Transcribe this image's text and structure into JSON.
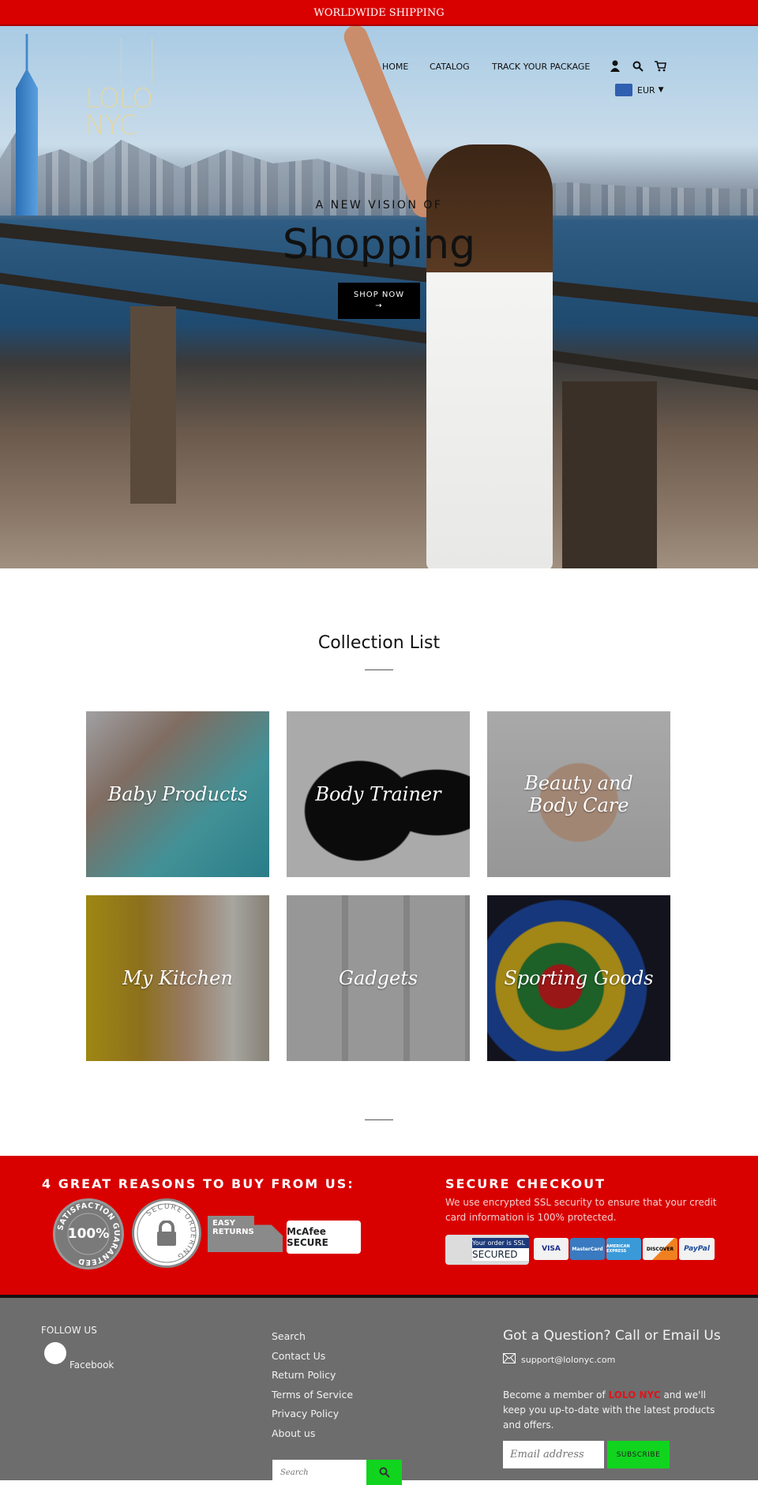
{
  "announcement": "WORLDWIDE SHIPPING",
  "logo": "LOLO NYC",
  "nav": {
    "items": [
      "HOME",
      "CATALOG",
      "TRACK YOUR PACKAGE"
    ],
    "icons": [
      "account-icon",
      "search-icon",
      "cart-icon"
    ],
    "currency": "EUR"
  },
  "hero": {
    "kicker": "A NEW VISION OF",
    "headline": "Shopping",
    "button": "SHOP NOW",
    "button_arrow": "→"
  },
  "collections": {
    "title": "Collection List",
    "items": [
      "Baby Products",
      "Body Trainer",
      "Beauty and Body Care",
      "My Kitchen",
      "Gadgets",
      "Sporting Goods"
    ]
  },
  "reasons": {
    "title": "4 GREAT REASONS TO BUY FROM US:",
    "badges": [
      "100%",
      "SATISFACTION GUARANTEED",
      "SECURE ORDERING",
      "EASY RETURNS",
      "McAfee SECURE"
    ]
  },
  "checkout": {
    "title": "SECURE CHECKOUT",
    "text": "We use encrypted SSL security to ensure that your credit card information is 100% protected.",
    "ssl_top": "Your order is SSL",
    "ssl_bottom": "SECURED",
    "cards": [
      "VISA",
      "MasterCard",
      "AMERICAN EXPRESS",
      "DISCOVER",
      "PayPal"
    ]
  },
  "footer": {
    "follow": "FOLLOW US",
    "facebook": "Facebook",
    "links": [
      "Search",
      "Contact Us",
      "Return Policy",
      "Terms of Service",
      "Privacy Policy",
      "About us"
    ],
    "search_placeholder": "Search",
    "question": "Got a Question? Call or Email Us",
    "email": "support@lolonyc.com",
    "member_pre": "Become a member of ",
    "member_brand": "LOLO NYC",
    "member_post": " and we'll keep you up-to-date with the latest products and offers.",
    "email_placeholder": "Email address",
    "subscribe": "SUBSCRIBE"
  },
  "colors": {
    "brand_red": "#d90000",
    "footer_gray": "#6d6d6d",
    "accent_green": "#11d41f"
  }
}
